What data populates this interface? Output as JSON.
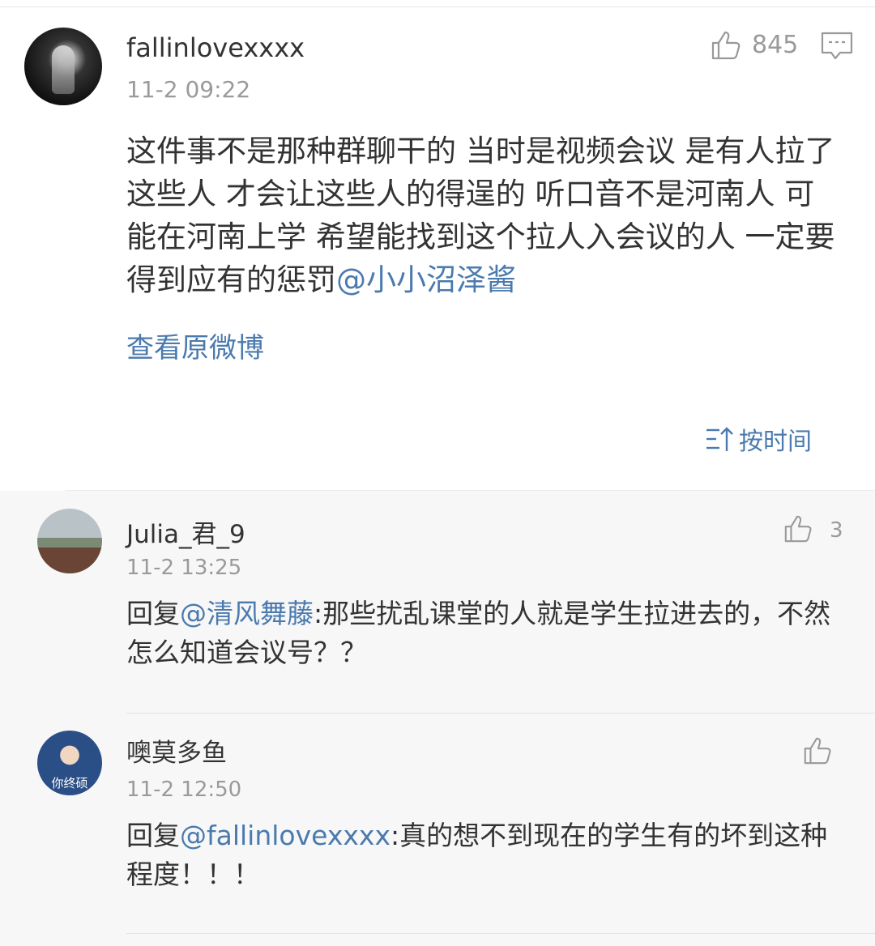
{
  "main_comment": {
    "username": "fallinlovexxxx",
    "time": "11-2 09:22",
    "likes": "845",
    "text": "这件事不是那种群聊干的 当时是视频会议 是有人拉了这些人 才会让这些人的得逞的 听口音不是河南人 可能在河南上学 希望能找到这个拉人入会议的人 一定要得到应有的惩罚",
    "mention": "@小小沼泽酱",
    "view_original": "查看原微博"
  },
  "sort": {
    "label": "按时间"
  },
  "replies": [
    {
      "username": "Julia_君_9",
      "time": "11-2 13:25",
      "likes": "3",
      "prefix": "回复",
      "mention": "@清风舞藤",
      "text": ":那些扰乱课堂的人就是学生拉进去的，不然怎么知道会议号？？"
    },
    {
      "username": "噢莫多鱼",
      "time": "11-2 12:50",
      "likes": "",
      "avatar_caption": "你终硕",
      "prefix": "回复",
      "mention": "@fallinlovexxxx",
      "text": ":真的想不到现在的学生有的坏到这种程度！！！"
    }
  ],
  "colors": {
    "link": "#4a7aae",
    "text": "#333333",
    "muted": "#9a9a9a"
  },
  "icons": [
    "thumbs-up-icon",
    "comment-icon",
    "sort-icon"
  ]
}
